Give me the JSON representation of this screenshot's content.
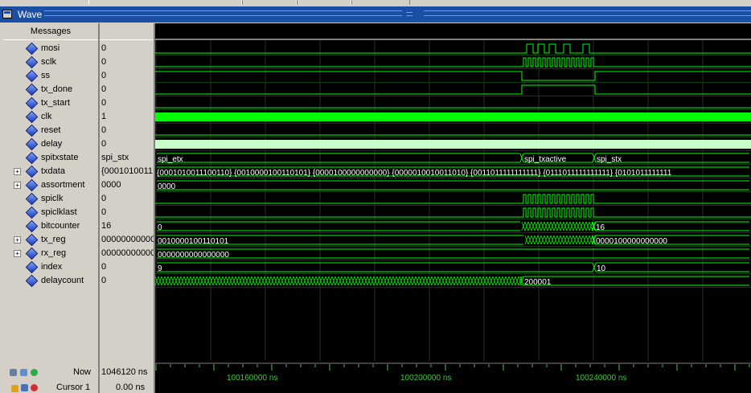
{
  "window": {
    "title": "Wave"
  },
  "columns": {
    "messages": "Messages"
  },
  "signals": [
    {
      "name": "mosi",
      "value": "0",
      "expandable": false,
      "wave_label": ""
    },
    {
      "name": "sclk",
      "value": "0",
      "expandable": false,
      "wave_label": ""
    },
    {
      "name": "ss",
      "value": "0",
      "expandable": false,
      "wave_label": ""
    },
    {
      "name": "tx_done",
      "value": "0",
      "expandable": false,
      "wave_label": ""
    },
    {
      "name": "tx_start",
      "value": "0",
      "expandable": false,
      "wave_label": ""
    },
    {
      "name": "clk",
      "value": "1",
      "expandable": false,
      "wave_label": ""
    },
    {
      "name": "reset",
      "value": "0",
      "expandable": false,
      "wave_label": ""
    },
    {
      "name": "delay",
      "value": "0",
      "expandable": false,
      "wave_label": ""
    },
    {
      "name": "spitxstate",
      "value": "spi_stx",
      "expandable": false,
      "wave_label": ""
    },
    {
      "name": "txdata",
      "value": "{0001010011",
      "expandable": true,
      "wave_label": ""
    },
    {
      "name": "assortment",
      "value": "0000",
      "expandable": true,
      "wave_label": ""
    },
    {
      "name": "spiclk",
      "value": "0",
      "expandable": false,
      "wave_label": ""
    },
    {
      "name": "spiclklast",
      "value": "0",
      "expandable": false,
      "wave_label": ""
    },
    {
      "name": "bitcounter",
      "value": "16",
      "expandable": false,
      "wave_label": ""
    },
    {
      "name": "tx_reg",
      "value": "00000000000",
      "expandable": true,
      "wave_label": ""
    },
    {
      "name": "rx_reg",
      "value": "00000000000",
      "expandable": true,
      "wave_label": ""
    },
    {
      "name": "index",
      "value": "0",
      "expandable": false,
      "wave_label": ""
    },
    {
      "name": "delaycount",
      "value": "0",
      "expandable": false,
      "wave_label": ""
    }
  ],
  "wave_labels": {
    "spitxstate": [
      "spi_etx",
      "spi_txactive",
      "spi_stx"
    ],
    "txdata": "{0001010011100110} {0010000100110101} {0000100000000000} {0000010010011010} {0011011111111111} {0111011111111111} {0101011111111",
    "assortment": "0000",
    "bitcounter": [
      "0",
      "16"
    ],
    "tx_reg": [
      "0010000100110101",
      "0000100000000000"
    ],
    "rx_reg": "0000000000000000",
    "index": [
      "9",
      "10"
    ],
    "delaycount": "200001"
  },
  "footer": {
    "now_label": "Now",
    "now_value": "1046120 ns",
    "cursor_label": "Cursor 1",
    "cursor_value": "0.00 ns",
    "time_ticks": [
      "100160000 ns",
      "100200000 ns",
      "100240000 ns"
    ]
  },
  "colors": {
    "wave_green": "#00ff00",
    "wave_dark_green": "#3cc83c",
    "title_bar": "#1b4fa6",
    "background": "#000000",
    "delay_bar": "#c8ffc8"
  }
}
